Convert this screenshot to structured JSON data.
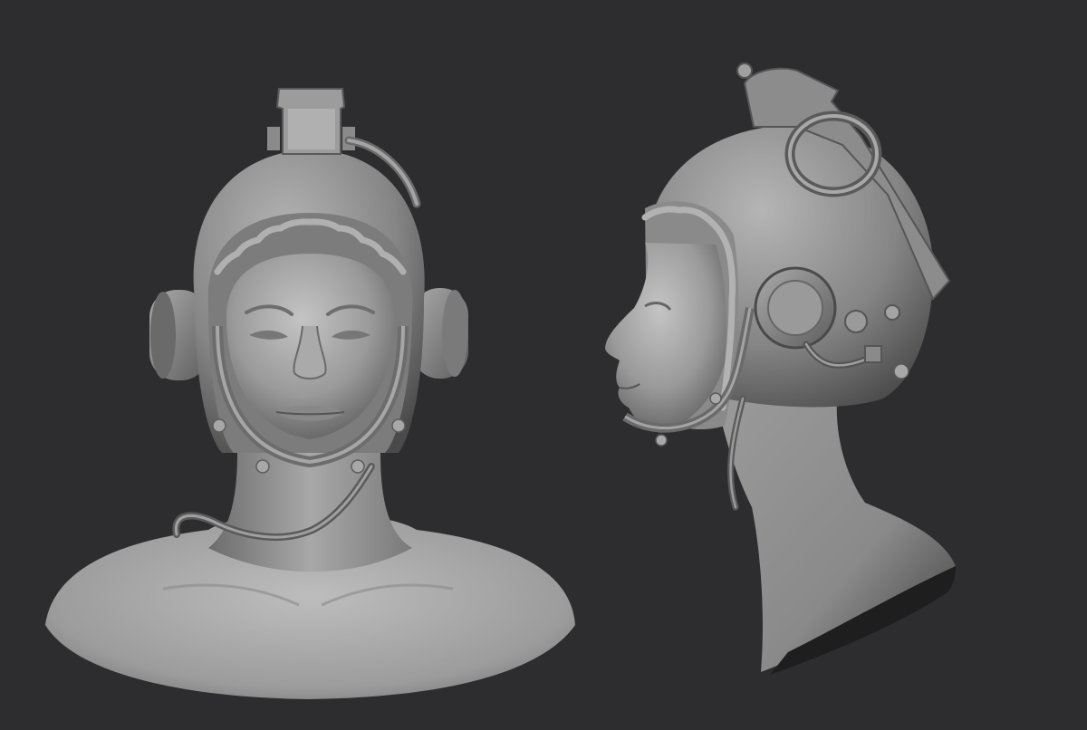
{
  "scene": {
    "background_color": "#2d2d2f",
    "material_light": "#b8b8b8",
    "material_mid": "#8a8a8a",
    "material_dark": "#4a4a4a",
    "views": [
      {
        "id": "front",
        "subject": "bust-with-grenade-helmet-front-view"
      },
      {
        "id": "side",
        "subject": "bust-with-grenade-helmet-side-view"
      }
    ]
  }
}
